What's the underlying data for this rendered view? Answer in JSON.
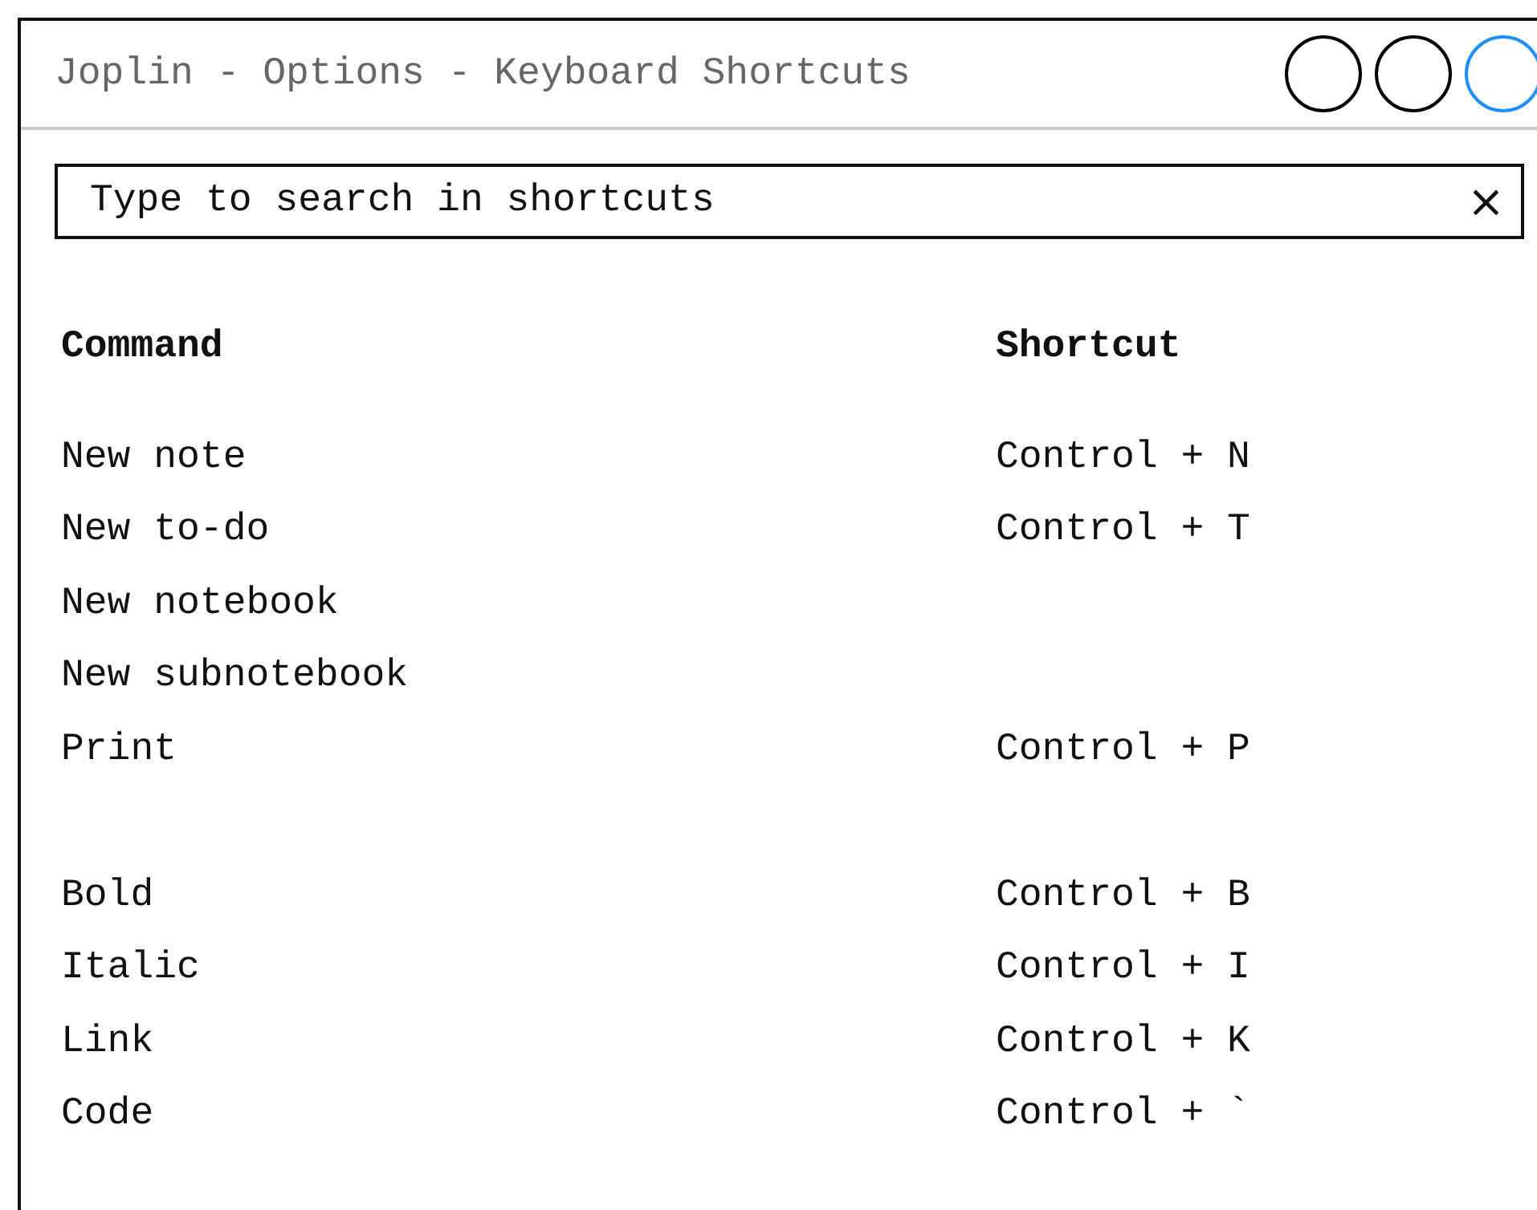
{
  "window": {
    "title": "Joplin - Options - Keyboard Shortcuts",
    "controls": [
      {
        "color": "#000000"
      },
      {
        "color": "#000000"
      },
      {
        "color": "#1e90ff"
      }
    ]
  },
  "search": {
    "placeholder": "Type to search in shortcuts",
    "clear": "×"
  },
  "table": {
    "columns": [
      "Command",
      "Shortcut"
    ],
    "groups": [
      [
        {
          "command": "New note",
          "shortcut": "Control + N"
        },
        {
          "command": "New to-do",
          "shortcut": "Control + T"
        },
        {
          "command": "New notebook"
        },
        {
          "command": "New subnotebook"
        },
        {
          "command": "Print",
          "shortcut": "Control + P"
        }
      ],
      [
        {
          "command": "Bold",
          "shortcut": "Control + B"
        },
        {
          "command": "Italic",
          "shortcut": "Control + I"
        },
        {
          "command": "Link",
          "shortcut": "Control + K"
        },
        {
          "command": "Code",
          "shortcut": "Control + `"
        }
      ]
    ]
  }
}
